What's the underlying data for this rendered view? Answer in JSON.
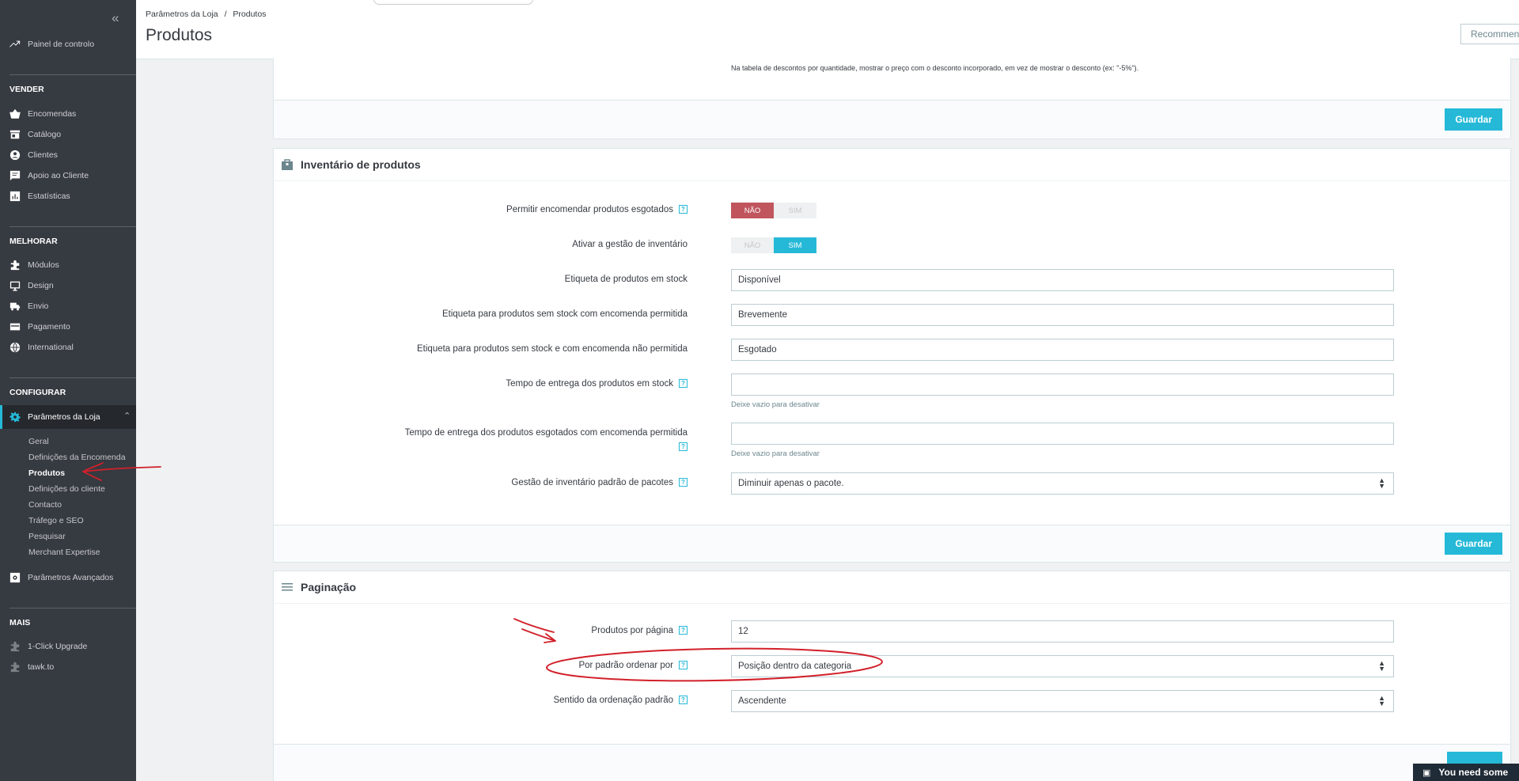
{
  "sidebar": {
    "collapse_glyph": "«",
    "dashboard": "Painel de controlo",
    "sections": {
      "vender": "VENDER",
      "melhorar": "MELHORAR",
      "configurar": "CONFIGURAR",
      "mais": "MAIS"
    },
    "vender_items": [
      "Encomendas",
      "Catálogo",
      "Clientes",
      "Apoio ao Cliente",
      "Estatísticas"
    ],
    "melhorar_items": [
      "Módulos",
      "Design",
      "Envio",
      "Pagamento",
      "International"
    ],
    "configurar_active": "Parâmetros da Loja",
    "configurar_sub": [
      "Geral",
      "Definições da Encomenda",
      "Produtos",
      "Definições do cliente",
      "Contacto",
      "Tráfego e SEO",
      "Pesquisar",
      "Merchant Expertise"
    ],
    "configurar_advanced": "Parâmetros Avançados",
    "mais_items": [
      "1-Click Upgrade",
      "tawk.to"
    ]
  },
  "header": {
    "breadcrumb_parent": "Parâmetros da Loja",
    "breadcrumb_sep": "/",
    "breadcrumb_current": "Produtos",
    "title": "Produtos",
    "recommend_label": "Recommen"
  },
  "top_panel": {
    "description": "Na tabela de descontos por quantidade, mostrar o preço com o desconto incorporado, em vez de mostrar o desconto (ex: \"-5%\").",
    "save_label": "Guardar"
  },
  "inventory": {
    "title": "Inventário de produtos",
    "help_glyph": "?",
    "allow_oos_label": "Permitir encomendar produtos esgotados",
    "stock_mgmt_label": "Ativar a gestão de inventário",
    "no_label": "NÃO",
    "yes_label": "SIM",
    "in_stock_label": "Etiqueta de produtos em stock",
    "in_stock_value": "Disponível",
    "oos_allowed_label": "Etiqueta para produtos sem stock com encomenda permitida",
    "oos_allowed_value": "Brevemente",
    "oos_denied_label": "Etiqueta para produtos sem stock e com encomenda não permitida",
    "oos_denied_value": "Esgotado",
    "delivery_in_stock_label": "Tempo de entrega dos produtos em stock",
    "delivery_in_stock_hint": "Deixe vazio para desativar",
    "delivery_oos_label": "Tempo de entrega dos produtos esgotados com encomenda permitida",
    "delivery_oos_hint": "Deixe vazio para desativar",
    "pack_label": "Gestão de inventário padrão de pacotes",
    "pack_value": "Diminuir apenas o pacote.",
    "save_label": "Guardar"
  },
  "pagination": {
    "title": "Paginação",
    "per_page_label": "Produtos por página",
    "per_page_value": "12",
    "order_by_label": "Por padrão ordenar por",
    "order_by_value": "Posição dentro da categoria",
    "order_dir_label": "Sentido da ordenação padrão",
    "order_dir_value": "Ascendente"
  },
  "chat_widget": {
    "text": "You need some"
  },
  "colors": {
    "accent": "#25b9d7",
    "sidebar": "#363a41",
    "danger": "#c0555d",
    "annotation": "#d2202a"
  }
}
